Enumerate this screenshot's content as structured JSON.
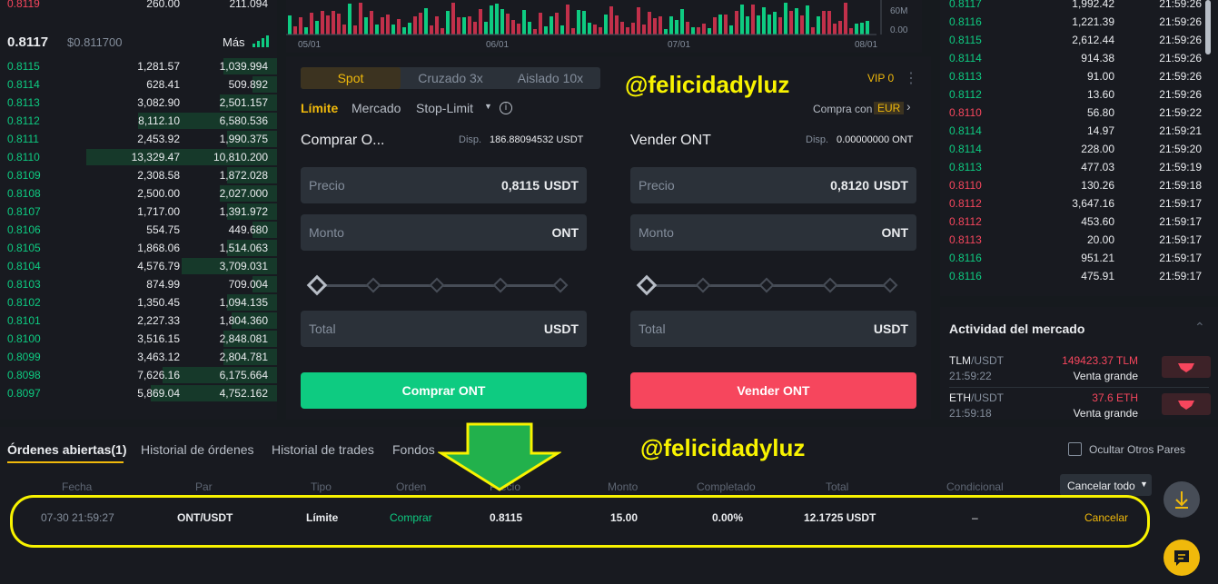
{
  "orderbook": {
    "top_partial": {
      "price": "0.8119",
      "amount": "260.00",
      "total": "211.094"
    },
    "last_price": "0.8117",
    "last_price_usd": "$0.811700",
    "more_label": "Más",
    "rows": [
      {
        "price": "0.8115",
        "amount": "1,281.57",
        "total": "1,039.994",
        "depth": 0.28
      },
      {
        "price": "0.8114",
        "amount": "628.41",
        "total": "509.892",
        "depth": 0.13
      },
      {
        "price": "0.8113",
        "amount": "3,082.90",
        "total": "2,501.157",
        "depth": 0.3
      },
      {
        "price": "0.8112",
        "amount": "8,112.10",
        "total": "6,580.536",
        "depth": 0.73
      },
      {
        "price": "0.8111",
        "amount": "2,453.92",
        "total": "1,990.375",
        "depth": 0.26
      },
      {
        "price": "0.8110",
        "amount": "13,329.47",
        "total": "10,810.200",
        "depth": 1.0
      },
      {
        "price": "0.8109",
        "amount": "2,308.58",
        "total": "1,872.028",
        "depth": 0.26
      },
      {
        "price": "0.8108",
        "amount": "2,500.00",
        "total": "2,027.000",
        "depth": 0.3
      },
      {
        "price": "0.8107",
        "amount": "1,717.00",
        "total": "1,391.972",
        "depth": 0.26
      },
      {
        "price": "0.8106",
        "amount": "554.75",
        "total": "449.680",
        "depth": 0.13
      },
      {
        "price": "0.8105",
        "amount": "1,868.06",
        "total": "1,514.063",
        "depth": 0.26
      },
      {
        "price": "0.8104",
        "amount": "4,576.79",
        "total": "3,709.031",
        "depth": 0.5
      },
      {
        "price": "0.8103",
        "amount": "874.99",
        "total": "709.004",
        "depth": 0.13
      },
      {
        "price": "0.8102",
        "amount": "1,350.45",
        "total": "1,094.135",
        "depth": 0.26
      },
      {
        "price": "0.8101",
        "amount": "2,227.33",
        "total": "1,804.360",
        "depth": 0.24
      },
      {
        "price": "0.8100",
        "amount": "3,516.15",
        "total": "2,848.081",
        "depth": 0.28
      },
      {
        "price": "0.8099",
        "amount": "3,463.12",
        "total": "2,804.781",
        "depth": 0.28
      },
      {
        "price": "0.8098",
        "amount": "7,626.16",
        "total": "6,175.664",
        "depth": 0.6
      },
      {
        "price": "0.8097",
        "amount": "5,869.04",
        "total": "4,752.162",
        "depth": 0.66
      }
    ]
  },
  "chart": {
    "dates": [
      "05/01",
      "06/01",
      "07/01",
      "08/01"
    ],
    "axis": [
      "60M",
      "0.00"
    ],
    "colors": {
      "up": "#0ecb81",
      "down": "#f6465d"
    }
  },
  "trade": {
    "tabs": [
      "Spot",
      "Cruzado 3x",
      "Aislado 10x"
    ],
    "vip": "VIP 0",
    "order_types": [
      "Límite",
      "Mercado",
      "Stop-Limit"
    ],
    "buy_with": "Compra con",
    "currency": "EUR",
    "buy": {
      "title": "Comprar O...",
      "disp_label": "Disp.",
      "disp_value": "186.88094532 USDT",
      "price_label": "Precio",
      "price_value": "0,8115",
      "price_unit": "USDT",
      "amount_label": "Monto",
      "amount_unit": "ONT",
      "total_label": "Total",
      "total_unit": "USDT",
      "button": "Comprar ONT"
    },
    "sell": {
      "title": "Vender ONT",
      "disp_label": "Disp.",
      "disp_value": "0.00000000 ONT",
      "price_label": "Precio",
      "price_value": "0,8120",
      "price_unit": "USDT",
      "amount_label": "Monto",
      "amount_unit": "ONT",
      "total_label": "Total",
      "total_unit": "USDT",
      "button": "Vender ONT"
    },
    "colors": {
      "buy": "#0ecb81",
      "sell": "#f6465d",
      "accent": "#f0b90b"
    }
  },
  "watermark": "@felicidadyluz",
  "trades": {
    "rows": [
      {
        "price": "0.8117",
        "amount": "1,992.42",
        "time": "21:59:26",
        "side": "buy"
      },
      {
        "price": "0.8116",
        "amount": "1,221.39",
        "time": "21:59:26",
        "side": "buy"
      },
      {
        "price": "0.8115",
        "amount": "2,612.44",
        "time": "21:59:26",
        "side": "buy"
      },
      {
        "price": "0.8114",
        "amount": "914.38",
        "time": "21:59:26",
        "side": "buy"
      },
      {
        "price": "0.8113",
        "amount": "91.00",
        "time": "21:59:26",
        "side": "buy"
      },
      {
        "price": "0.8112",
        "amount": "13.60",
        "time": "21:59:26",
        "side": "buy"
      },
      {
        "price": "0.8110",
        "amount": "56.80",
        "time": "21:59:22",
        "side": "sell"
      },
      {
        "price": "0.8114",
        "amount": "14.97",
        "time": "21:59:21",
        "side": "buy"
      },
      {
        "price": "0.8114",
        "amount": "228.00",
        "time": "21:59:20",
        "side": "buy"
      },
      {
        "price": "0.8113",
        "amount": "477.03",
        "time": "21:59:19",
        "side": "buy"
      },
      {
        "price": "0.8110",
        "amount": "130.26",
        "time": "21:59:18",
        "side": "sell"
      },
      {
        "price": "0.8112",
        "amount": "3,647.16",
        "time": "21:59:17",
        "side": "sell"
      },
      {
        "price": "0.8112",
        "amount": "453.60",
        "time": "21:59:17",
        "side": "sell"
      },
      {
        "price": "0.8113",
        "amount": "20.00",
        "time": "21:59:17",
        "side": "sell"
      },
      {
        "price": "0.8116",
        "amount": "951.21",
        "time": "21:59:17",
        "side": "buy"
      },
      {
        "price": "0.8116",
        "amount": "475.91",
        "time": "21:59:17",
        "side": "buy"
      }
    ]
  },
  "activity": {
    "title": "Actividad del mercado",
    "items": [
      {
        "pair_base": "TLM",
        "pair_quote": "/USDT",
        "time": "21:59:22",
        "amount": "149423.37 TLM",
        "label": "Venta grande"
      },
      {
        "pair_base": "ETH",
        "pair_quote": "/USDT",
        "time": "21:59:18",
        "amount": "37.6 ETH",
        "label": "Venta grande"
      }
    ]
  },
  "orders": {
    "tabs": [
      "Órdenes abiertas(1)",
      "Historial de órdenes",
      "Historial de trades",
      "Fondos"
    ],
    "hide_others": "Ocultar Otros Pares",
    "cancel_all": "Cancelar todo",
    "columns": [
      "Fecha",
      "Par",
      "Tipo",
      "Orden",
      "Precio",
      "Monto",
      "Completado",
      "Total",
      "Condicional"
    ],
    "row": {
      "date": "07-30 21:59:27",
      "pair": "ONT/USDT",
      "type": "Límite",
      "side": "Comprar",
      "price": "0.8115",
      "amount": "15.00",
      "filled": "0.00%",
      "total": "12.1725 USDT",
      "conditional": "–",
      "action": "Cancelar"
    }
  }
}
